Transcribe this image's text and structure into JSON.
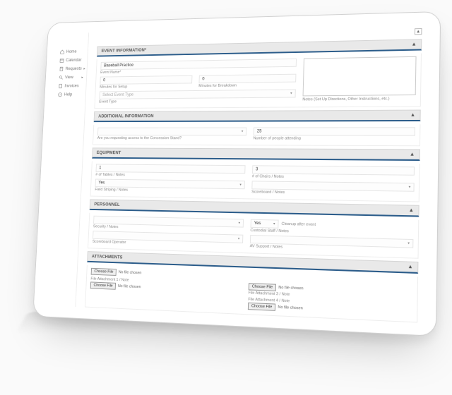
{
  "sidebar": {
    "items": [
      {
        "icon": "home-icon",
        "label": "Home"
      },
      {
        "icon": "calendar-icon",
        "label": "Calendar"
      },
      {
        "icon": "request-icon",
        "label": "Requests"
      },
      {
        "icon": "search-icon",
        "label": "View"
      },
      {
        "icon": "invoice-icon",
        "label": "Invoices"
      },
      {
        "icon": "help-icon",
        "label": "Help"
      }
    ]
  },
  "toggle_glyph": "▲",
  "sections": {
    "event_info": {
      "title": "EVENT INFORMATION*",
      "event_name_value": "Baseball Practice",
      "event_name_label": "Event Name*",
      "setup_value": "0",
      "setup_label": "Minutes for Setup",
      "breakdown_value": "0",
      "breakdown_label": "Minutes for Breakdown",
      "event_type_placeholder": "Select Event Type",
      "event_type_label": "Event Type",
      "notes_caption": "Notes (Set Up Directions, Other Instructions, etc.)"
    },
    "additional": {
      "title": "ADDITIONAL INFORMATION",
      "concession_label": "Are you requesting access to the Concession Stand?",
      "attending_value": "25",
      "attending_label": "Number of people attending"
    },
    "equipment": {
      "title": "EQUIPMENT",
      "tables_value": "1",
      "tables_label": "# of Tables / Notes",
      "chairs_value": "3",
      "chairs_label": "# of Chairs / Notes",
      "striping_value": "Yes",
      "striping_label": "Field Striping / Notes",
      "scoreboard_label": "Scoreboard / Notes"
    },
    "personnel": {
      "title": "PERSONNEL",
      "security_label": "Security / Notes",
      "cleanup_value": "Yes",
      "cleanup_desc": "Cleanup after event",
      "custodial_label": "Custodial Staff / Notes",
      "scoreboard_op_label": "Scoreboard Operator",
      "av_label": "AV Support / Notes"
    },
    "attachments": {
      "title": "ATTACHMENTS",
      "choose_label": "Choose File",
      "no_file": "No file chosen",
      "att1_label": "File Attachment 1 / Note",
      "att3_label": "File Attachment 3 / Note",
      "att4_label": "File Attachment 4 / Note"
    }
  }
}
